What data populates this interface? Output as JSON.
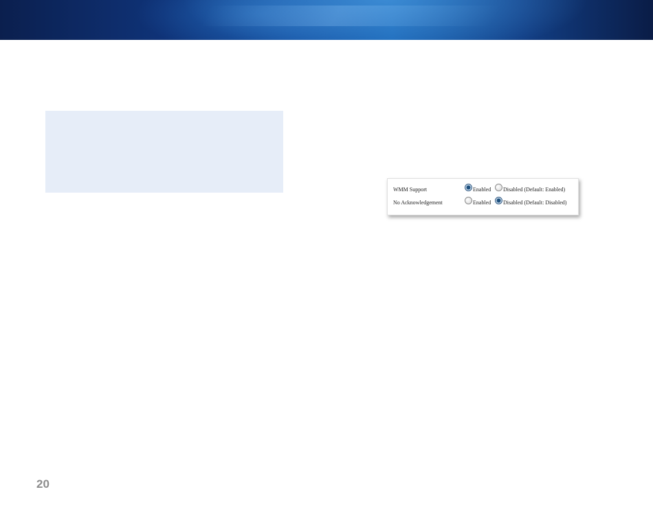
{
  "screenshot": {
    "rows": [
      {
        "label": "WMM Support",
        "options": [
          {
            "label": "Enabled",
            "checked": true
          },
          {
            "label": "Disabled (Default: Enabled)",
            "checked": false
          }
        ]
      },
      {
        "label": "No Acknowledgement",
        "options": [
          {
            "label": "Enabled",
            "checked": false
          },
          {
            "label": "Disabled (Default: Disabled)",
            "checked": true
          }
        ]
      }
    ]
  },
  "footer": {
    "page_number": "20"
  },
  "colors": {
    "banner_dark": "#0b1f4e",
    "banner_light": "#1a67b8",
    "note_box": "#e6edf8",
    "page_number": "#8c8c8c",
    "radio_checked": "#1d4f7d"
  }
}
